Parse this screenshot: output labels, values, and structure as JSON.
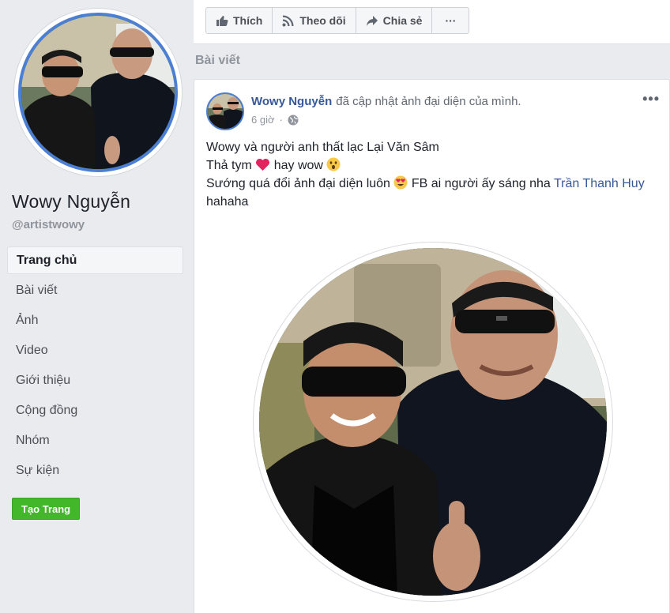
{
  "profile": {
    "name": "Wowy Nguyễn",
    "handle": "@artistwowy",
    "ring_color": "#4a7fd4"
  },
  "nav": {
    "items": [
      {
        "label": "Trang chủ",
        "active": true
      },
      {
        "label": "Bài viết"
      },
      {
        "label": "Ảnh"
      },
      {
        "label": "Video"
      },
      {
        "label": "Giới thiệu"
      },
      {
        "label": "Cộng đồng"
      },
      {
        "label": "Nhóm"
      },
      {
        "label": "Sự kiện"
      }
    ],
    "create_page": "Tạo Trang"
  },
  "actions": {
    "like": "Thích",
    "follow": "Theo dõi",
    "share": "Chia sẻ",
    "more": "···"
  },
  "section_title": "Bài viết",
  "post": {
    "author": "Wowy Nguyễn",
    "action_text": "đã cập nhật ảnh đại diện của mình.",
    "time": "6 giờ",
    "more": "•••",
    "line1": "Wowy và người anh thất lạc Lại Văn Sâm",
    "line2_a": "Thả tym",
    "line2_b": "hay wow",
    "line3_a": "Sướng quá đổi ảnh đại diện luôn",
    "line3_b": "FB ai người ấy sáng nha",
    "mention": "Trần Thanh Huy",
    "line3_c": "hahaha"
  },
  "colors": {
    "link": "#365899",
    "green_button": "#42b72a",
    "background": "#e9ebee"
  }
}
